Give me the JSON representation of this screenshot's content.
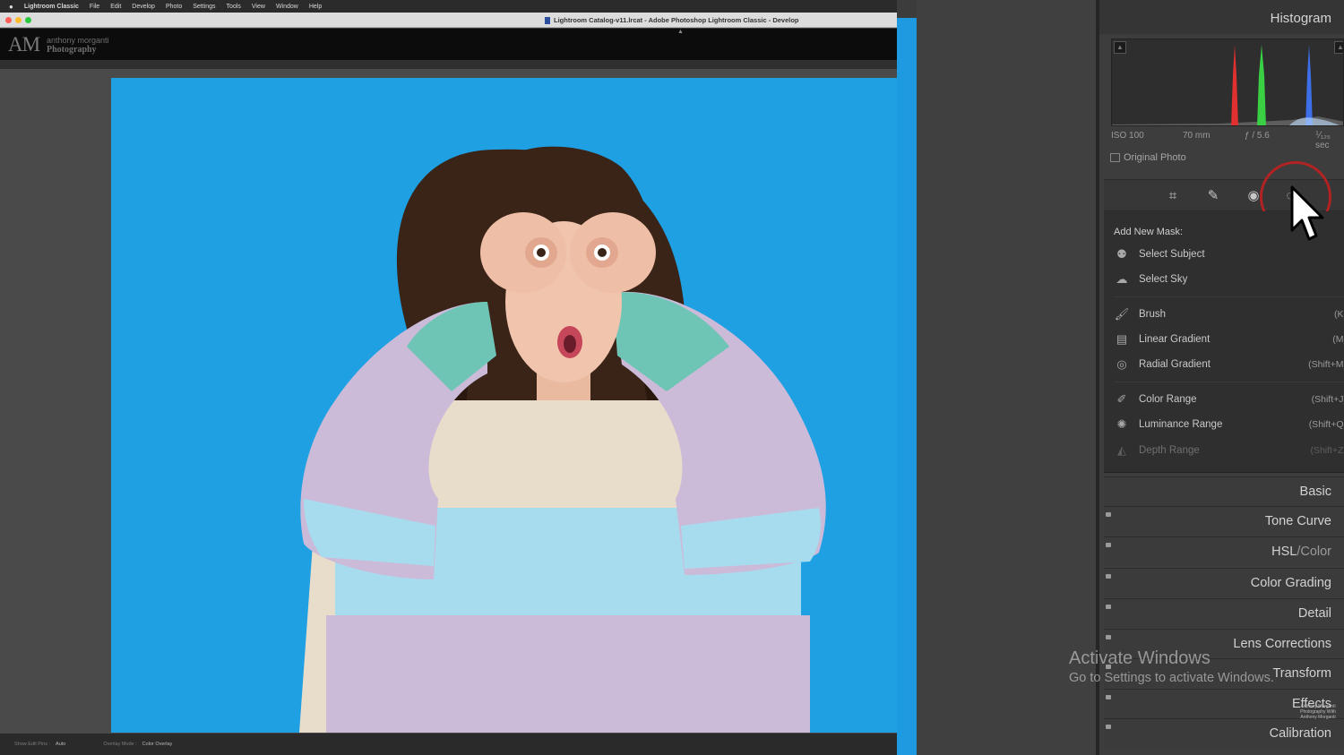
{
  "menubar": {
    "app_name": "Lightroom Classic",
    "items": [
      "File",
      "Edit",
      "Develop",
      "Photo",
      "Settings",
      "Tools",
      "View",
      "Window",
      "Help"
    ]
  },
  "window": {
    "title": "Lightroom Catalog-v11.lrcat - Adobe Photoshop Lightroom Classic - Develop"
  },
  "identity_plate": {
    "initials": "AM",
    "line1": "anthony morganti",
    "line2": "Photography"
  },
  "bottom_toolbar": {
    "show_edit_pins_label": "Show Edit Pins :",
    "show_edit_pins_value": "Auto",
    "overlay_mode_label": "Overlay Mode :",
    "overlay_mode_value": "Color Overlay"
  },
  "histogram": {
    "title": "Histogram",
    "iso": "ISO 100",
    "focal_length": "70 mm",
    "aperture": "ƒ / 5.6",
    "shutter": "⅟₁₂₅ sec",
    "original_photo_label": "Original Photo"
  },
  "tool_strip": {
    "icons": [
      "crop-icon",
      "healing-icon",
      "red-eye-icon",
      "masking-icon"
    ]
  },
  "masks": {
    "heading": "Add New Mask:",
    "items": [
      {
        "label": "Select Subject",
        "shortcut": ""
      },
      {
        "label": "Select Sky",
        "shortcut": ""
      },
      {
        "label": "Brush",
        "shortcut": "(K)"
      },
      {
        "label": "Linear Gradient",
        "shortcut": "(M)"
      },
      {
        "label": "Radial Gradient",
        "shortcut": "(Shift+M)"
      },
      {
        "label": "Color Range",
        "shortcut": "(Shift+J)"
      },
      {
        "label": "Luminance Range",
        "shortcut": "(Shift+Q)"
      },
      {
        "label": "Depth Range",
        "shortcut": "(Shift+Z)"
      }
    ]
  },
  "sections": {
    "basic": "Basic",
    "tone_curve": "Tone Curve",
    "hsl": "HSL",
    "hsl_sep": "/",
    "color": "Color",
    "color_grading": "Color Grading",
    "detail": "Detail",
    "lens_corrections": "Lens Corrections",
    "transform": "Transform",
    "effects": "Effects",
    "calibration": "Calibration"
  },
  "activation": {
    "line1": "Activate Windows",
    "line2": "Go to Settings to activate Windows."
  },
  "watermark": "Anthony Morganti Photography With Anthony Morganti",
  "colors": {
    "photo_background": "#1ea0e3",
    "highlight_ring": "#c81e1e"
  }
}
